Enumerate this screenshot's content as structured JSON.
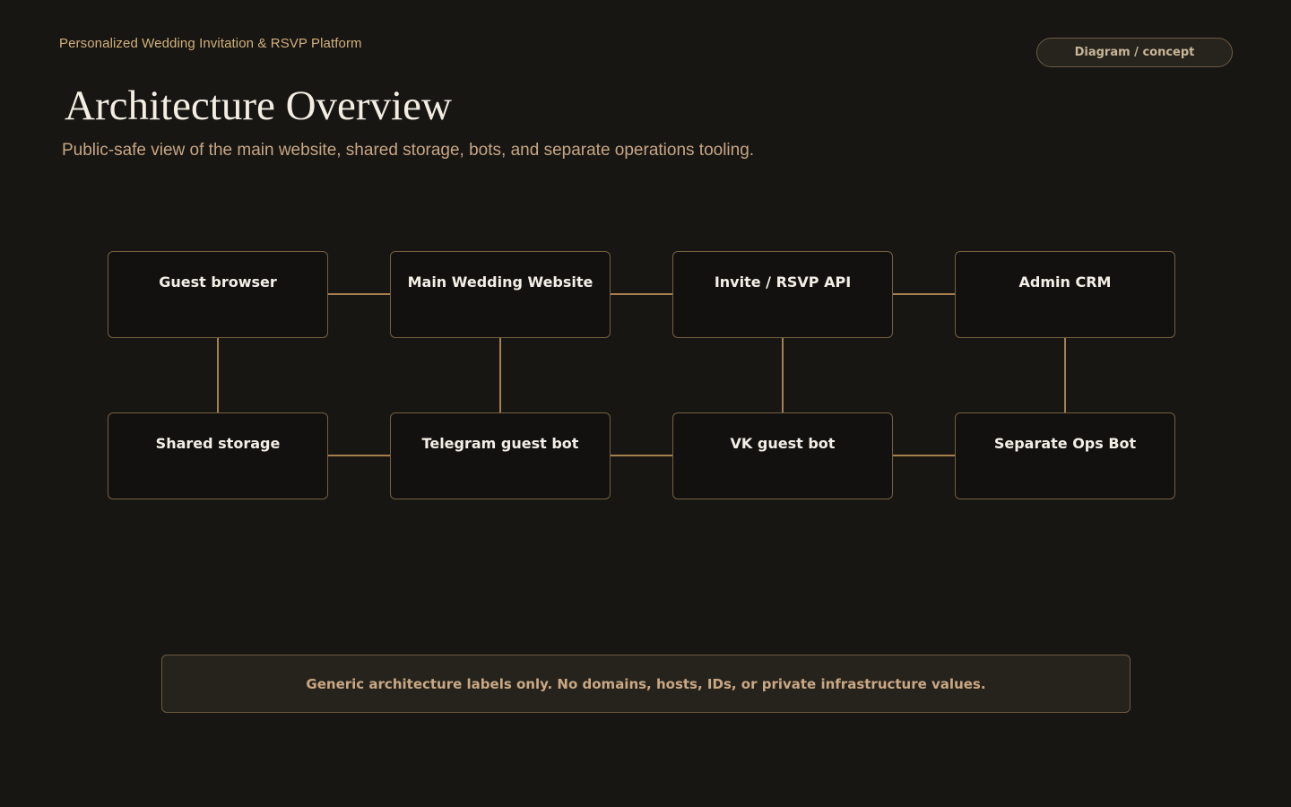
{
  "header": {
    "eyebrow": "Personalized Wedding Invitation & RSVP Platform",
    "badge": "Diagram / concept",
    "title": "Architecture Overview",
    "subtitle": "Public-safe view of the main website, shared storage, bots, and separate operations tooling."
  },
  "diagram": {
    "nodes": [
      {
        "id": "guest-browser",
        "label": "Guest browser"
      },
      {
        "id": "main-wedding-website",
        "label": "Main Wedding Website"
      },
      {
        "id": "invite-rsvp-api",
        "label": "Invite / RSVP API"
      },
      {
        "id": "admin-crm",
        "label": "Admin CRM"
      },
      {
        "id": "shared-storage",
        "label": "Shared storage"
      },
      {
        "id": "telegram-guest-bot",
        "label": "Telegram guest bot"
      },
      {
        "id": "vk-guest-bot",
        "label": "VK guest bot"
      },
      {
        "id": "separate-ops-bot",
        "label": "Separate Ops Bot"
      }
    ],
    "edges": [
      {
        "from": "guest-browser",
        "to": "main-wedding-website"
      },
      {
        "from": "main-wedding-website",
        "to": "invite-rsvp-api"
      },
      {
        "from": "invite-rsvp-api",
        "to": "admin-crm"
      },
      {
        "from": "shared-storage",
        "to": "telegram-guest-bot"
      },
      {
        "from": "telegram-guest-bot",
        "to": "vk-guest-bot"
      },
      {
        "from": "vk-guest-bot",
        "to": "separate-ops-bot"
      },
      {
        "from": "guest-browser",
        "to": "shared-storage"
      },
      {
        "from": "main-wedding-website",
        "to": "telegram-guest-bot"
      },
      {
        "from": "invite-rsvp-api",
        "to": "vk-guest-bot"
      },
      {
        "from": "admin-crm",
        "to": "separate-ops-bot"
      }
    ]
  },
  "footer": {
    "note": "Generic architecture labels only. No domains, hosts, IDs, or private infrastructure values."
  },
  "colors": {
    "background": "#171613",
    "accent": "#a57f4e",
    "node_border": "#73603f"
  }
}
